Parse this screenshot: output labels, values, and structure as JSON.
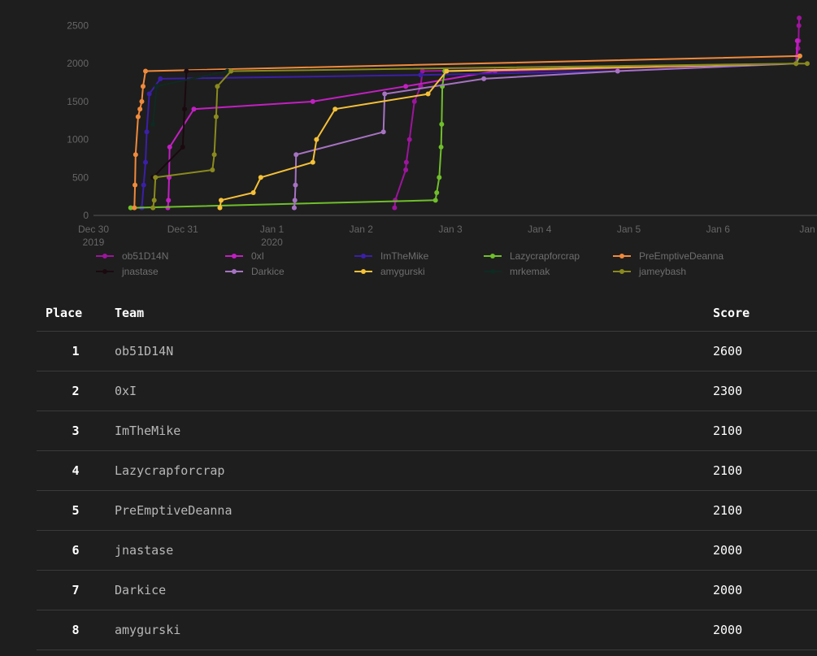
{
  "chart_data": {
    "type": "line",
    "title": "",
    "xlabel": "",
    "ylabel": "",
    "ylim": [
      0,
      2600
    ],
    "yticks": [
      0,
      500,
      1000,
      1500,
      2000,
      2500
    ],
    "xlim": [
      "2019-12-30T00:00",
      "2020-01-07T00:00"
    ],
    "xticks": [
      {
        "t": "2019-12-30T00:00",
        "label": "Dec 30",
        "sub": "2019"
      },
      {
        "t": "2019-12-31T00:00",
        "label": "Dec 31",
        "sub": ""
      },
      {
        "t": "2020-01-01T00:00",
        "label": "Jan 1",
        "sub": "2020"
      },
      {
        "t": "2020-01-02T00:00",
        "label": "Jan 2",
        "sub": ""
      },
      {
        "t": "2020-01-03T00:00",
        "label": "Jan 3",
        "sub": ""
      },
      {
        "t": "2020-01-04T00:00",
        "label": "Jan 4",
        "sub": ""
      },
      {
        "t": "2020-01-05T00:00",
        "label": "Jan 5",
        "sub": ""
      },
      {
        "t": "2020-01-06T00:00",
        "label": "Jan 6",
        "sub": ""
      },
      {
        "t": "2020-01-07T00:00",
        "label": "Jan",
        "sub": ""
      }
    ],
    "grid": false,
    "legend": "bottom",
    "series": [
      {
        "name": "ob51D14N",
        "color": "#9c159c",
        "points": [
          [
            "2020-01-02T09:00",
            100
          ],
          [
            "2020-01-02T09:10",
            200
          ],
          [
            "2020-01-02T12:00",
            600
          ],
          [
            "2020-01-02T12:10",
            700
          ],
          [
            "2020-01-02T13:00",
            1000
          ],
          [
            "2020-01-02T14:20",
            1500
          ],
          [
            "2020-01-02T16:00",
            1700
          ],
          [
            "2020-01-02T16:30",
            1900
          ],
          [
            "2020-01-06T21:00",
            2000
          ],
          [
            "2020-01-06T21:20",
            2100
          ],
          [
            "2020-01-06T21:30",
            2200
          ],
          [
            "2020-01-06T21:40",
            2300
          ],
          [
            "2020-01-06T21:45",
            2500
          ],
          [
            "2020-01-06T21:50",
            2600
          ]
        ]
      },
      {
        "name": "0xI",
        "color": "#c21fc2",
        "points": [
          [
            "2019-12-30T20:00",
            100
          ],
          [
            "2019-12-30T20:10",
            200
          ],
          [
            "2019-12-30T20:20",
            500
          ],
          [
            "2019-12-30T20:30",
            900
          ],
          [
            "2019-12-31T03:00",
            1400
          ],
          [
            "2020-01-01T11:00",
            1500
          ],
          [
            "2020-01-02T12:00",
            1700
          ],
          [
            "2020-01-03T12:00",
            1900
          ],
          [
            "2020-01-06T21:00",
            2000
          ],
          [
            "2020-01-06T21:20",
            2300
          ]
        ]
      },
      {
        "name": "ImTheMike",
        "color": "#3b1fa8",
        "points": [
          [
            "2019-12-30T13:00",
            100
          ],
          [
            "2019-12-30T13:30",
            400
          ],
          [
            "2019-12-30T14:00",
            700
          ],
          [
            "2019-12-30T14:20",
            1100
          ],
          [
            "2019-12-30T15:00",
            1600
          ],
          [
            "2019-12-30T18:00",
            1800
          ],
          [
            "2020-01-02T16:00",
            1850
          ],
          [
            "2020-01-04T21:00",
            1900
          ],
          [
            "2020-01-06T21:00",
            2000
          ],
          [
            "2020-01-06T22:00",
            2100
          ]
        ]
      },
      {
        "name": "Lazycrapforcrap",
        "color": "#6fbf2a",
        "points": [
          [
            "2019-12-30T10:00",
            100
          ],
          [
            "2020-01-02T20:00",
            200
          ],
          [
            "2020-01-02T20:20",
            300
          ],
          [
            "2020-01-02T21:00",
            500
          ],
          [
            "2020-01-02T21:30",
            900
          ],
          [
            "2020-01-02T21:40",
            1200
          ],
          [
            "2020-01-02T21:50",
            1700
          ],
          [
            "2020-01-02T22:30",
            1900
          ],
          [
            "2020-01-06T21:00",
            2000
          ],
          [
            "2020-01-06T22:00",
            2100
          ]
        ]
      },
      {
        "name": "PreEmptiveDeanna",
        "color": "#f08a3c",
        "points": [
          [
            "2019-12-30T11:00",
            100
          ],
          [
            "2019-12-30T11:10",
            400
          ],
          [
            "2019-12-30T11:20",
            800
          ],
          [
            "2019-12-30T12:00",
            1300
          ],
          [
            "2019-12-30T12:30",
            1400
          ],
          [
            "2019-12-30T13:00",
            1500
          ],
          [
            "2019-12-30T13:20",
            1700
          ],
          [
            "2019-12-30T14:00",
            1900
          ],
          [
            "2020-01-06T22:00",
            2100
          ]
        ]
      },
      {
        "name": "jnastase",
        "color": "#1a0a10",
        "points": [
          [
            "2019-12-30T16:00",
            500
          ],
          [
            "2019-12-31T00:00",
            900
          ],
          [
            "2019-12-31T00:30",
            1400
          ],
          [
            "2019-12-31T01:00",
            1900
          ],
          [
            "2020-01-06T21:00",
            2000
          ]
        ]
      },
      {
        "name": "Darkice",
        "color": "#a673c2",
        "points": [
          [
            "2020-01-01T06:00",
            100
          ],
          [
            "2020-01-01T06:10",
            200
          ],
          [
            "2020-01-01T06:20",
            400
          ],
          [
            "2020-01-01T06:30",
            800
          ],
          [
            "2020-01-02T06:00",
            1100
          ],
          [
            "2020-01-02T06:20",
            1600
          ],
          [
            "2020-01-03T09:00",
            1800
          ],
          [
            "2020-01-04T21:00",
            1900
          ],
          [
            "2020-01-06T21:00",
            2000
          ]
        ]
      },
      {
        "name": "amygurski",
        "color": "#f5c038",
        "points": [
          [
            "2019-12-31T10:00",
            100
          ],
          [
            "2019-12-31T10:20",
            200
          ],
          [
            "2019-12-31T19:00",
            300
          ],
          [
            "2019-12-31T21:00",
            500
          ],
          [
            "2020-01-01T11:00",
            700
          ],
          [
            "2020-01-01T12:00",
            1000
          ],
          [
            "2020-01-01T17:00",
            1400
          ],
          [
            "2020-01-02T18:00",
            1600
          ],
          [
            "2020-01-02T23:00",
            1900
          ],
          [
            "2020-01-06T21:00",
            2000
          ]
        ]
      },
      {
        "name": "mrkemak",
        "color": "#0f2a22",
        "points": [
          [
            "2019-12-30T16:00",
            1200
          ],
          [
            "2019-12-30T17:00",
            1700
          ],
          [
            "2019-12-31T12:00",
            1900
          ],
          [
            "2020-01-06T21:00",
            2000
          ]
        ]
      },
      {
        "name": "jameybash",
        "color": "#8a8a1e",
        "points": [
          [
            "2019-12-30T16:00",
            100
          ],
          [
            "2019-12-30T16:20",
            200
          ],
          [
            "2019-12-30T16:40",
            500
          ],
          [
            "2019-12-31T08:00",
            600
          ],
          [
            "2019-12-31T08:30",
            800
          ],
          [
            "2019-12-31T09:00",
            1300
          ],
          [
            "2019-12-31T09:20",
            1700
          ],
          [
            "2019-12-31T13:00",
            1900
          ],
          [
            "2020-01-06T21:00",
            2000
          ],
          [
            "2020-01-07T00:00",
            2000
          ]
        ]
      }
    ]
  },
  "scoreboard": {
    "headers": {
      "place": "Place",
      "team": "Team",
      "score": "Score"
    },
    "rows": [
      {
        "place": "1",
        "team": "ob51D14N",
        "score": "2600"
      },
      {
        "place": "2",
        "team": "0xI",
        "score": "2300"
      },
      {
        "place": "3",
        "team": "ImTheMike",
        "score": "2100"
      },
      {
        "place": "4",
        "team": "Lazycrapforcrap",
        "score": "2100"
      },
      {
        "place": "5",
        "team": "PreEmptiveDeanna",
        "score": "2100"
      },
      {
        "place": "6",
        "team": "jnastase",
        "score": "2000"
      },
      {
        "place": "7",
        "team": "Darkice",
        "score": "2000"
      },
      {
        "place": "8",
        "team": "amygurski",
        "score": "2000"
      }
    ]
  }
}
